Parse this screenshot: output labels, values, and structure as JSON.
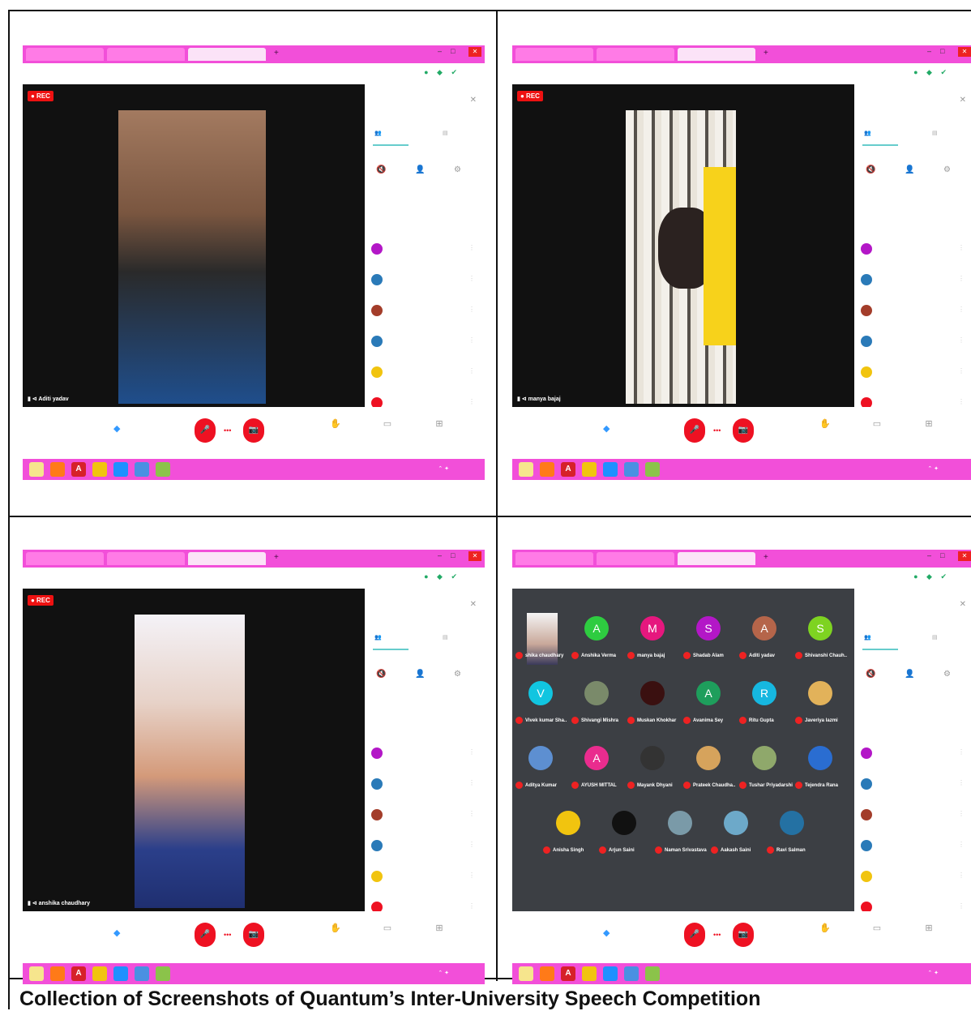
{
  "caption": "Collection of Screenshots of Quantum’s Inter-University Speech Competition",
  "colors": {
    "tabbar": "#f24fd9",
    "record": "#e11111",
    "end_call": "#e11122",
    "accent": "#44aa88"
  },
  "panels": [
    {
      "speaker": "Aditi yadav"
    },
    {
      "speaker": "manya bajaj"
    },
    {
      "speaker": "anshika chaudhary"
    },
    {
      "speaker": "",
      "gallery": [
        {
          "name": "shika chaudhary",
          "initial": "",
          "color": "#cfd8dc"
        },
        {
          "name": "Anshika Verma",
          "initial": "A",
          "color": "#2ecc40"
        },
        {
          "name": "manya bajaj",
          "initial": "M",
          "color": "#e6177e"
        },
        {
          "name": "Shadab Alam",
          "initial": "S",
          "color": "#b317c7"
        },
        {
          "name": "Aditi yadav",
          "initial": "A",
          "color": "#b5654a"
        },
        {
          "name": "Shivanshi Chauh..",
          "initial": "S",
          "color": "#7ed321"
        },
        {
          "name": "Vivek kumar Sha..",
          "initial": "V",
          "color": "#11c5e0"
        },
        {
          "name": "Shivangi Mishra",
          "initial": "",
          "color": "#7a8a6a"
        },
        {
          "name": "Muskan Khokhar",
          "initial": "",
          "color": "#3a1010"
        },
        {
          "name": "Avanima Sey",
          "initial": "A",
          "color": "#1e9e5c"
        },
        {
          "name": "Ritu Gupta",
          "initial": "R",
          "color": "#16b7e0"
        },
        {
          "name": "Javeriya Iazmi",
          "initial": "",
          "color": "#e2b25a"
        },
        {
          "name": "Aditya Kumar",
          "initial": "",
          "color": "#5d8fd1"
        },
        {
          "name": "AYUSH MITTAL",
          "initial": "A",
          "color": "#ea2c8e"
        },
        {
          "name": "Mayank Dhyani",
          "initial": "",
          "color": "#333333"
        },
        {
          "name": "Prateek Chaudha..",
          "initial": "",
          "color": "#d6a35c"
        },
        {
          "name": "Tushar Priyadarshi",
          "initial": "",
          "color": "#8fa86b"
        },
        {
          "name": "Tejendra Rana",
          "initial": "",
          "color": "#2a6dd1"
        },
        {
          "name": "Anisha Singh",
          "initial": "",
          "color": "#f1c40f"
        },
        {
          "name": "Arjun Saini",
          "initial": "",
          "color": "#111111"
        },
        {
          "name": "Naman Srivastava",
          "initial": "",
          "color": "#7a9aa8"
        },
        {
          "name": "Aakash Saini",
          "initial": "",
          "color": "#6da9c9"
        },
        {
          "name": "Ravi Salman",
          "initial": "",
          "color": "#2471a3"
        }
      ]
    }
  ]
}
